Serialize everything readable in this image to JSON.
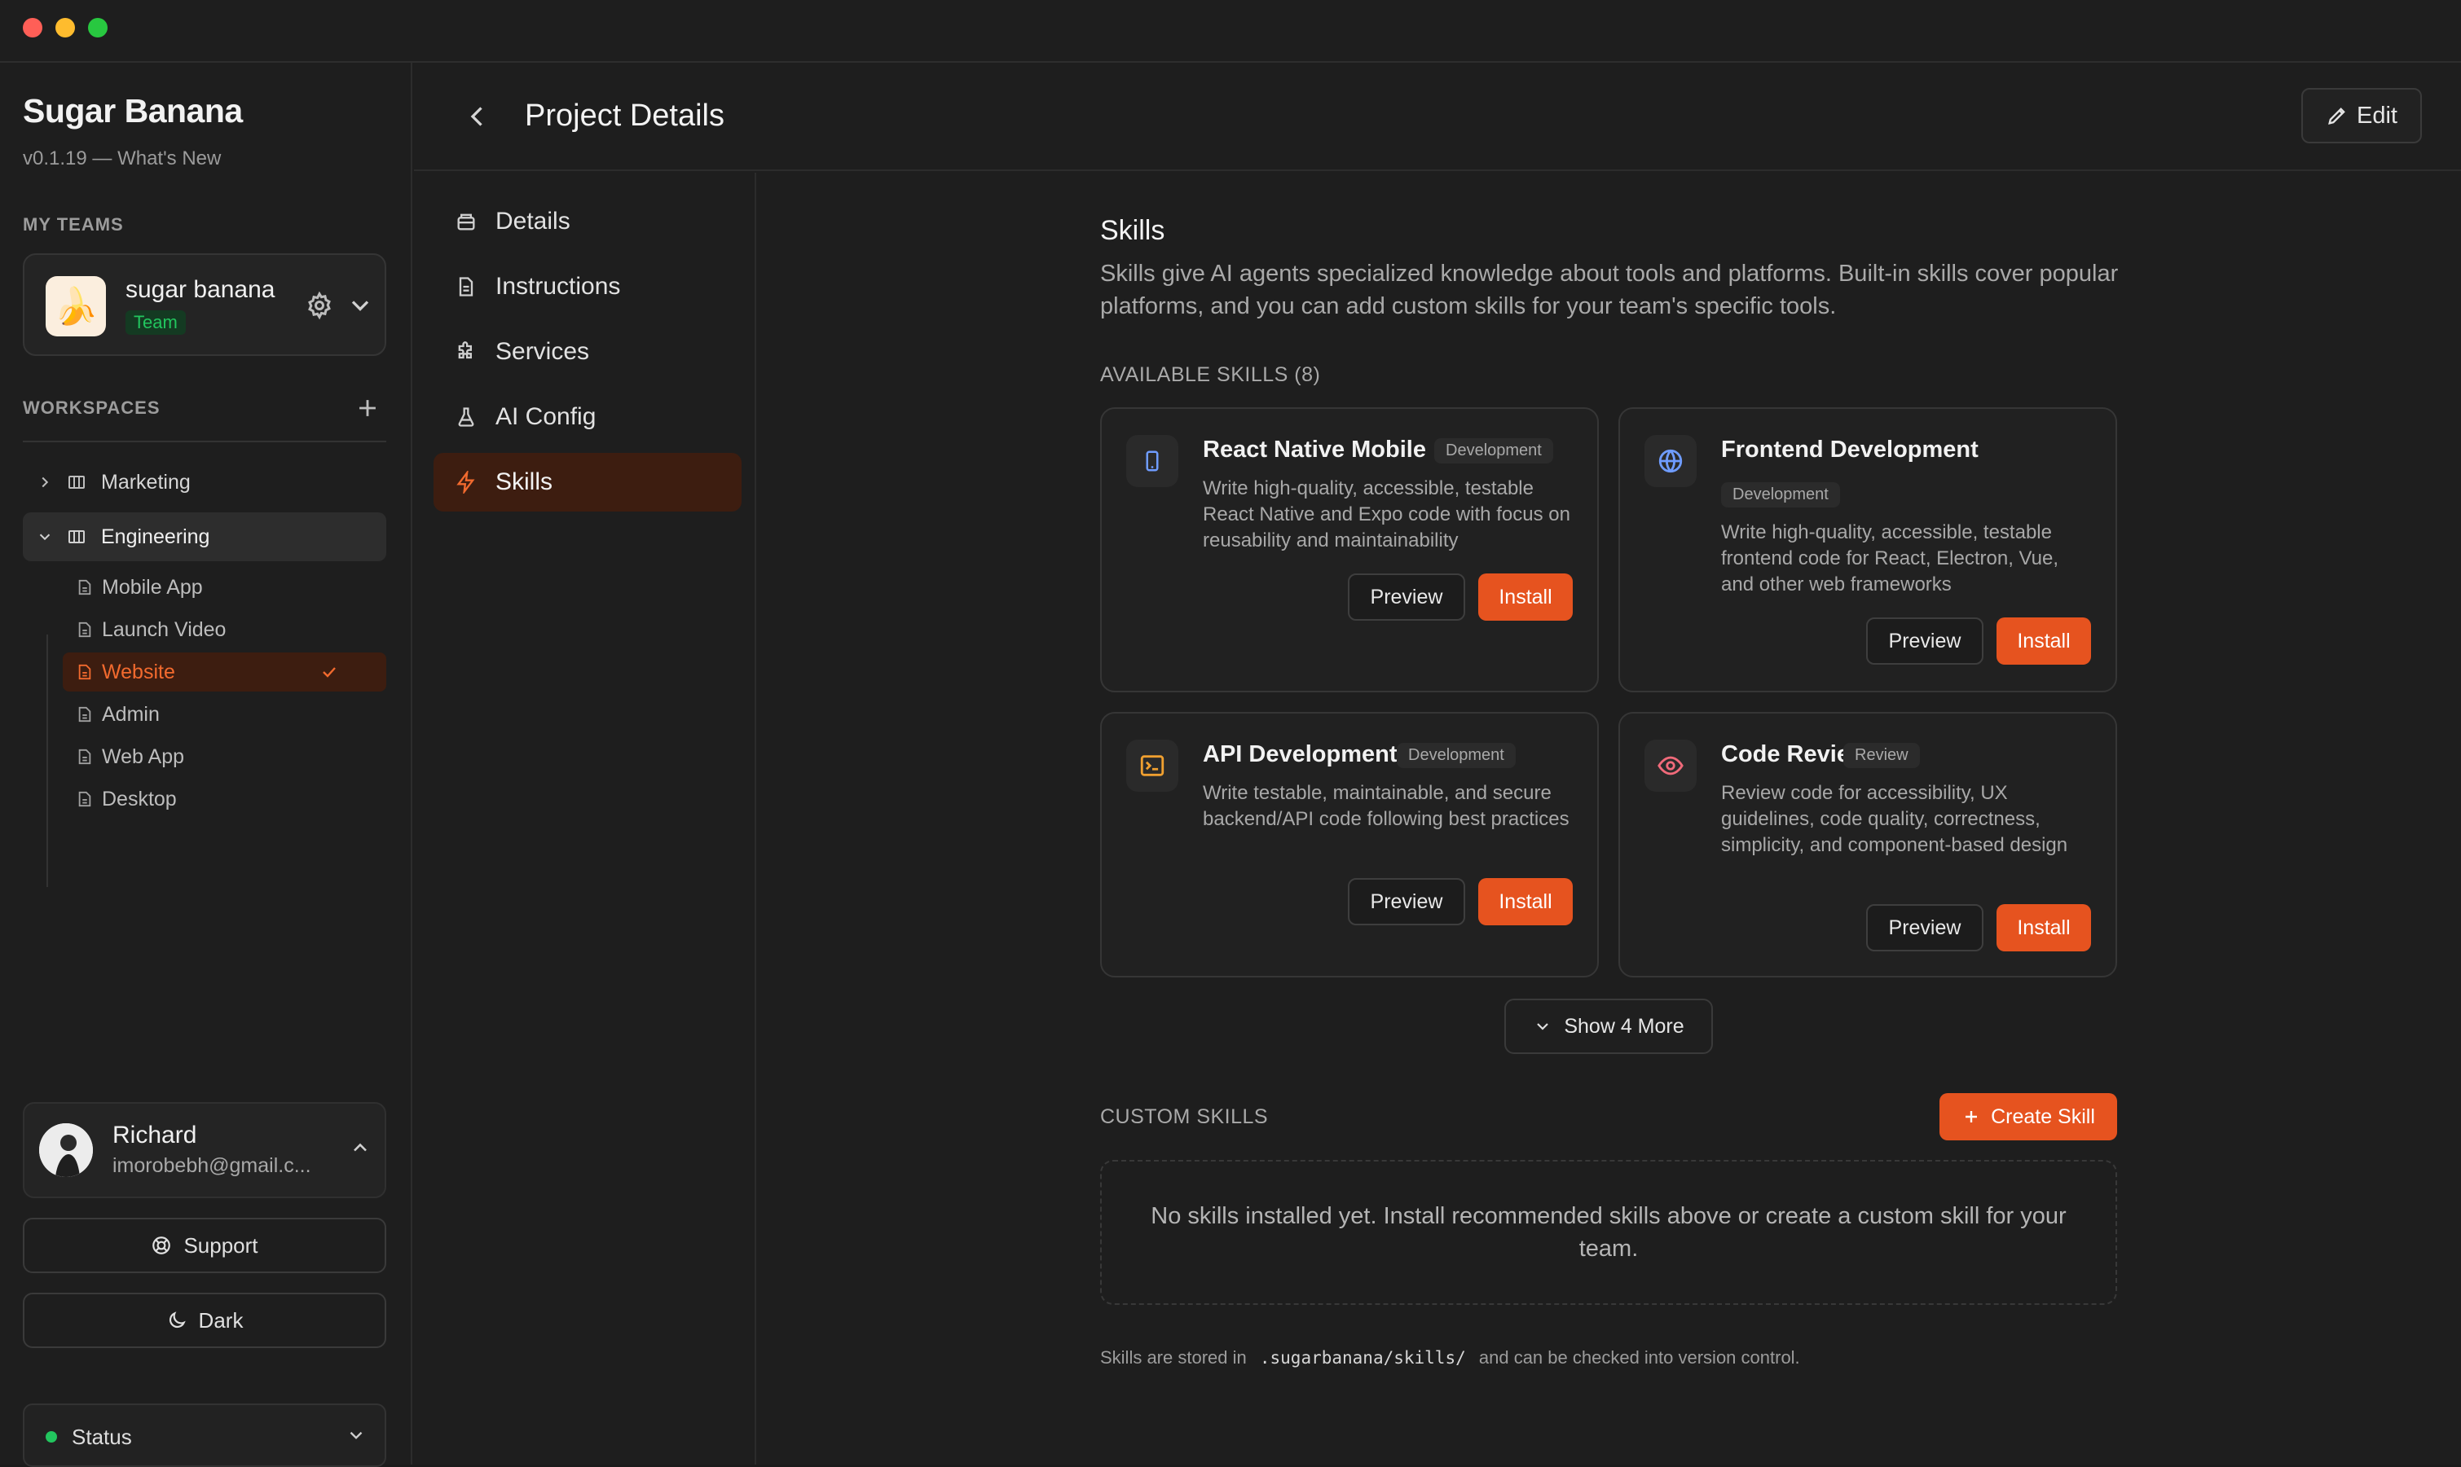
{
  "app": {
    "name": "Sugar Banana",
    "version": "v0.1.19 — What's New"
  },
  "sidebar": {
    "teams_label": "MY TEAMS",
    "team": {
      "name": "sugar banana",
      "badge": "Team",
      "avatar_emoji": "🍌"
    },
    "workspaces_label": "WORKSPACES",
    "workspaces": [
      {
        "label": "Marketing",
        "expanded": false
      },
      {
        "label": "Engineering",
        "expanded": true
      }
    ],
    "projects": [
      {
        "label": "Mobile App"
      },
      {
        "label": "Launch Video"
      },
      {
        "label": "Website",
        "selected": true
      },
      {
        "label": "Admin"
      },
      {
        "label": "Web App"
      },
      {
        "label": "Desktop"
      }
    ],
    "user": {
      "name": "Richard",
      "email": "imorobebh@gmail.c..."
    },
    "support_label": "Support",
    "theme_label": "Dark",
    "status_label": "Status"
  },
  "header": {
    "title": "Project Details",
    "edit_label": "Edit"
  },
  "subnav": {
    "items": [
      {
        "label": "Details",
        "icon": "box-icon"
      },
      {
        "label": "Instructions",
        "icon": "document-icon"
      },
      {
        "label": "Services",
        "icon": "puzzle-icon"
      },
      {
        "label": "AI Config",
        "icon": "flask-icon"
      },
      {
        "label": "Skills",
        "icon": "lightning-icon",
        "active": true
      }
    ]
  },
  "skills": {
    "title": "Skills",
    "description": "Skills give AI agents specialized knowledge about tools and platforms. Built-in skills cover popular platforms, and you can add custom skills for your team's specific tools.",
    "available_label": "AVAILABLE SKILLS (8)",
    "cards": [
      {
        "title": "React Native Mobile",
        "badge": "Development",
        "icon": "phone-icon",
        "description": "Write high-quality, accessible, testable React Native and Expo code with focus on reusability and maintainability",
        "preview": "Preview",
        "install": "Install"
      },
      {
        "title": "Frontend Development",
        "badge": "Development",
        "icon": "globe-icon",
        "description": "Write high-quality, accessible, testable frontend code for React, Electron, Vue, and other web frameworks",
        "preview": "Preview",
        "install": "Install"
      },
      {
        "title": "API Development",
        "badge": "Development",
        "icon": "terminal-icon",
        "description": "Write testable, maintainable, and secure backend/API code following best practices",
        "preview": "Preview",
        "install": "Install"
      },
      {
        "title": "Code Reviewer",
        "badge": "Review",
        "icon": "eye-icon",
        "description": "Review code for accessibility, UX guidelines, code quality, correctness, simplicity, and component-based design",
        "preview": "Preview",
        "install": "Install"
      }
    ],
    "show_more_label": "Show 4 More",
    "custom_label": "CUSTOM SKILLS",
    "create_label": "Create Skill",
    "empty_text": "No skills installed yet. Install recommended skills above or create a custom skill for your team.",
    "footnote_prefix": "Skills are stored in",
    "footnote_path": ".sugarbanana/skills/",
    "footnote_suffix": "and can be checked into version control."
  },
  "colors": {
    "accent": "#e6531f",
    "selected_bg": "#3d1d10",
    "selected_text": "#f26a2e",
    "status_ok": "#22c55e"
  }
}
